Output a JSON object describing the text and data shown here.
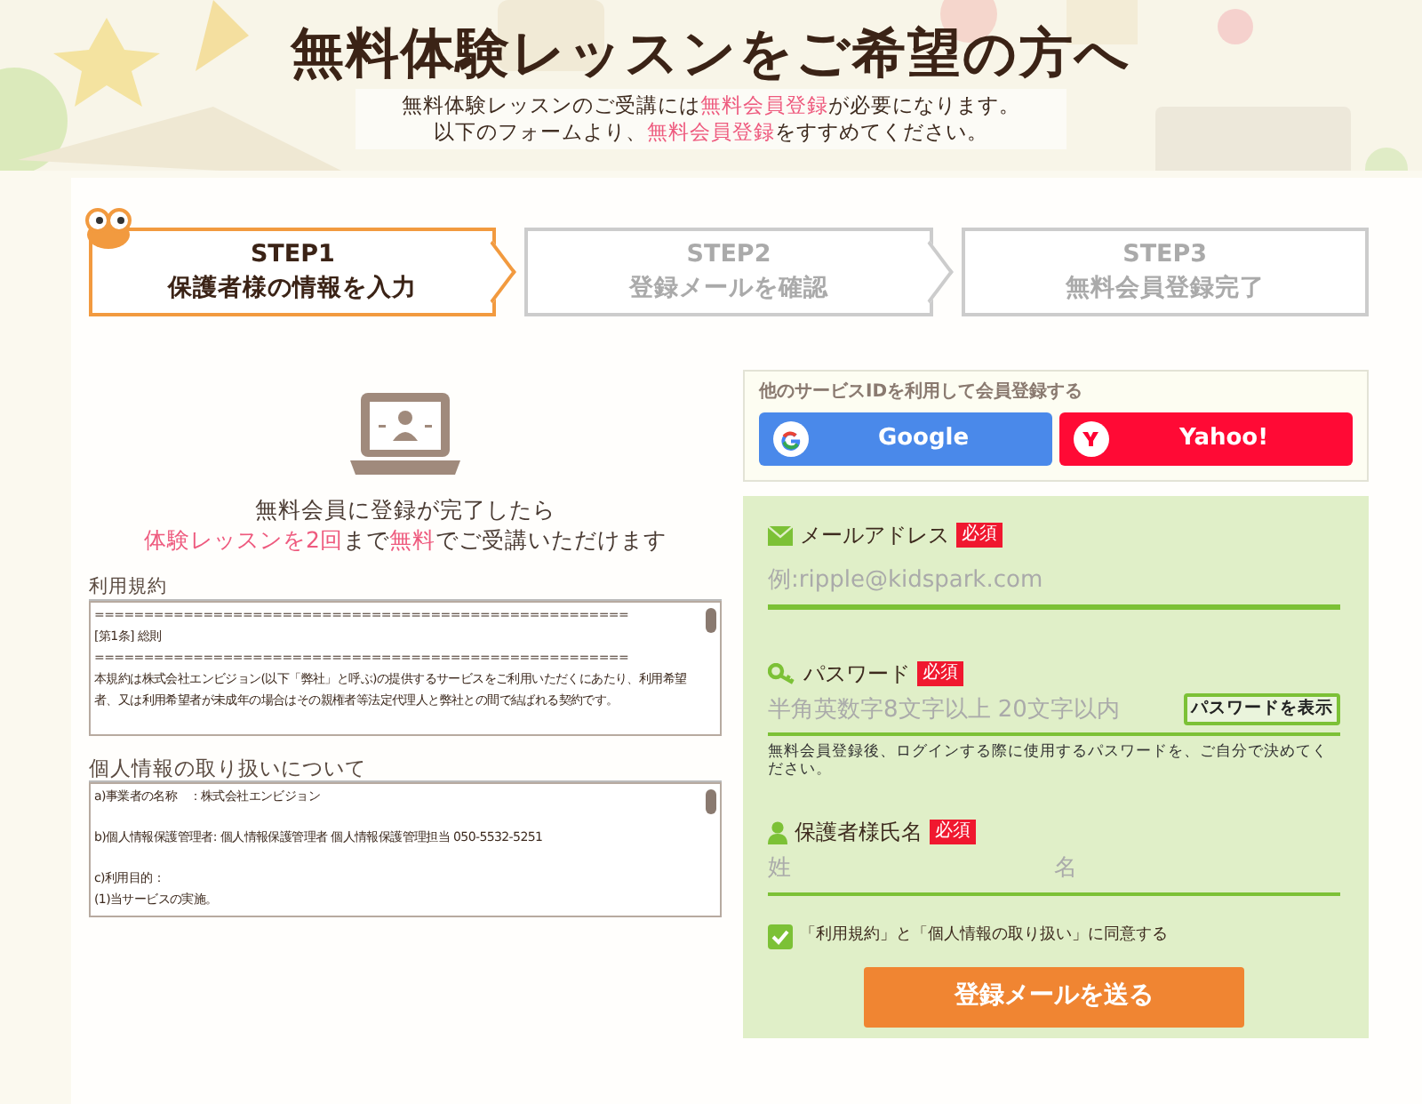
{
  "title": "無料体験レッスンをご希望の方へ",
  "intro": [
    [
      {
        "text": "無料体験レッスンのご受講には",
        "highlight": false
      },
      {
        "text": "無料会員登録",
        "highlight": true
      },
      {
        "text": "が必要になります。",
        "highlight": false
      }
    ],
    [
      {
        "text": "以下のフォームより、",
        "highlight": false
      },
      {
        "text": "無料会員登録",
        "highlight": true
      },
      {
        "text": "をすすめてください。",
        "highlight": false
      }
    ]
  ],
  "steps": [
    {
      "label": "STEP1",
      "caption": "保護者様の情報を入力",
      "selected": true
    },
    {
      "label": "STEP2",
      "caption": "登録メールを確認",
      "selected": false
    },
    {
      "label": "STEP3",
      "caption": "無料会員登録完了",
      "selected": false
    }
  ],
  "promo": [
    [
      {
        "text": "無料会員に登録が完了したら",
        "highlight": false
      }
    ],
    [
      {
        "text": "体験レッスンを2回",
        "highlight": true
      },
      {
        "text": "まで",
        "highlight": false
      },
      {
        "text": "無料",
        "highlight": true
      },
      {
        "text": "でご受講いただけます",
        "highlight": false
      }
    ]
  ],
  "documents": [
    {
      "label": "利用規約",
      "paragraphs": [
        [
          "======================================================",
          "[第1条] 総則",
          "======================================================",
          "本規約は株式会社エンビジョン(以下「弊社」と呼ぶ)の提供するサービスをご利用いただくにあたり、利用希望者、又は利用希望者が未成年の場合はその親権者等法定代理人と弊社との間で結ばれる契約です。"
        ]
      ]
    },
    {
      "label": "個人情報の取り扱いについて",
      "paragraphs": [
        [
          "a)事業者の名称　：株式会社エンビジョン"
        ],
        [
          "b)個人情報保護管理者: 個人情報保護管理者 個人情報保護管理担当 050-5532-5251"
        ],
        [
          "c)利用目的：",
          "(1)当サービスの実施。"
        ]
      ]
    }
  ],
  "social": {
    "heading": "他のサービスIDを利用して会員登録する",
    "buttons": [
      {
        "kind": "google",
        "label": "Google"
      },
      {
        "kind": "yahoo",
        "label": "Yahoo!"
      }
    ]
  },
  "form": {
    "email": {
      "label": "メールアドレス",
      "required": "必須",
      "placeholder": "例:ripple@kidspark.com"
    },
    "password": {
      "label": "パスワード",
      "required": "必須",
      "placeholder": "半角英数字8文字以上 20文字以内",
      "toggle": "パスワードを表示",
      "hint": "無料会員登録後、ログインする際に使用するパスワードを、ご自分で決めてください。"
    },
    "name": {
      "label": "保護者様氏名",
      "required": "必須",
      "placeholders": [
        "姓",
        "名"
      ]
    },
    "agree": {
      "label": "「利用規約」と「個人情報の取り扱い」に同意する",
      "checked": true
    },
    "submit": "登録メールを送る"
  }
}
